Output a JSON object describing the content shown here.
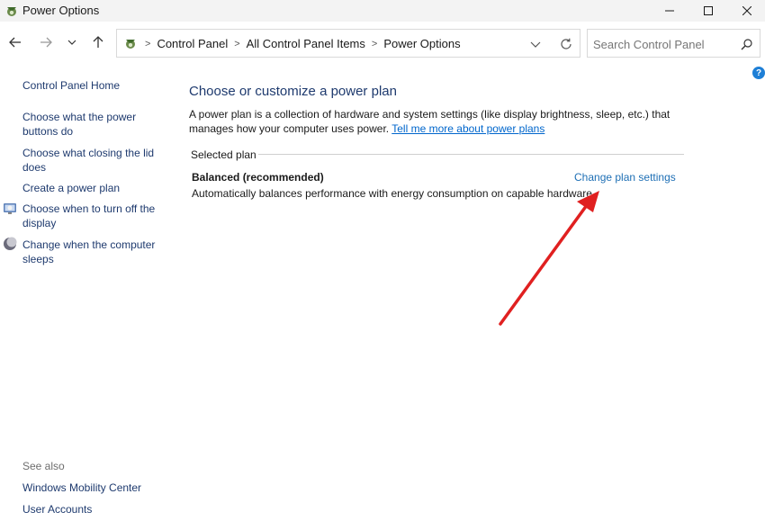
{
  "window": {
    "title": "Power Options"
  },
  "address": {
    "crumbs": [
      "Control Panel",
      "All Control Panel Items",
      "Power Options"
    ],
    "sep": ">"
  },
  "search": {
    "placeholder": "Search Control Panel"
  },
  "help": {
    "label": "?"
  },
  "sidebar": {
    "home": "Control Panel Home",
    "links": [
      "Choose what the power buttons do",
      "Choose what closing the lid does",
      "Create a power plan",
      "Choose when to turn off the display",
      "Change when the computer sleeps"
    ],
    "see_also_label": "See also",
    "see_also": [
      "Windows Mobility Center",
      "User Accounts"
    ]
  },
  "main": {
    "title": "Choose or customize a power plan",
    "description": "A power plan is a collection of hardware and system settings (like display brightness, sleep, etc.) that manages how your computer uses power.",
    "description_link": "Tell me more about power plans",
    "selected_label": "Selected plan",
    "plan_name": "Balanced (recommended)",
    "plan_description": "Automatically balances performance with energy consumption on capable hardware.",
    "change_link": "Change plan settings"
  },
  "annotation": {
    "arrow_color": "#e02020"
  }
}
